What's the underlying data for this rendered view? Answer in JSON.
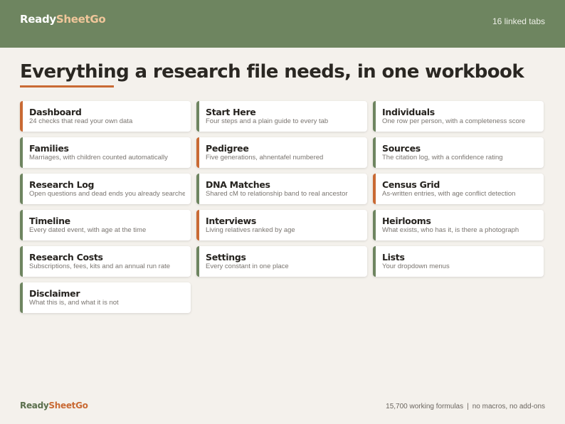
{
  "header": {
    "brand_part1": "Ready",
    "brand_part2": "SheetGo",
    "tab_count": "16 linked tabs"
  },
  "headline": "Everything a research file needs, in one workbook",
  "colors": {
    "header_bg": "#6e8560",
    "accent_orange": "#c96a34",
    "accent_green": "#6e8560",
    "page_bg": "#f4f1ec"
  },
  "cards": [
    {
      "title": "Dashboard",
      "desc": "24 checks that read your own data",
      "accent": "orange"
    },
    {
      "title": "Start Here",
      "desc": "Four steps and a plain guide to every tab",
      "accent": "green"
    },
    {
      "title": "Individuals",
      "desc": "One row per person, with a completeness score",
      "accent": "green"
    },
    {
      "title": "Families",
      "desc": "Marriages, with children counted automatically",
      "accent": "green"
    },
    {
      "title": "Pedigree",
      "desc": "Five generations, ahnentafel numbered",
      "accent": "orange"
    },
    {
      "title": "Sources",
      "desc": "The citation log, with a confidence rating",
      "accent": "green"
    },
    {
      "title": "Research Log",
      "desc": "Open questions and dead ends you already searched",
      "accent": "green"
    },
    {
      "title": "DNA Matches",
      "desc": "Shared cM to relationship band to real ancestor",
      "accent": "green"
    },
    {
      "title": "Census Grid",
      "desc": "As-written entries, with age conflict detection",
      "accent": "orange"
    },
    {
      "title": "Timeline",
      "desc": "Every dated event, with age at the time",
      "accent": "green"
    },
    {
      "title": "Interviews",
      "desc": "Living relatives ranked by age",
      "accent": "orange"
    },
    {
      "title": "Heirlooms",
      "desc": "What exists, who has it, is there a photograph",
      "accent": "green"
    },
    {
      "title": "Research Costs",
      "desc": "Subscriptions, fees, kits and an annual run rate",
      "accent": "green"
    },
    {
      "title": "Settings",
      "desc": "Every constant in one place",
      "accent": "green"
    },
    {
      "title": "Lists",
      "desc": "Your dropdown menus",
      "accent": "green"
    },
    {
      "title": "Disclaimer",
      "desc": "What this is, and what it is not",
      "accent": "green"
    }
  ],
  "footer": {
    "brand_part1": "Ready",
    "brand_part2": "SheetGo",
    "formulas": "15,700 working formulas",
    "separator": "|",
    "no_macros": "no macros, no add-ons"
  }
}
